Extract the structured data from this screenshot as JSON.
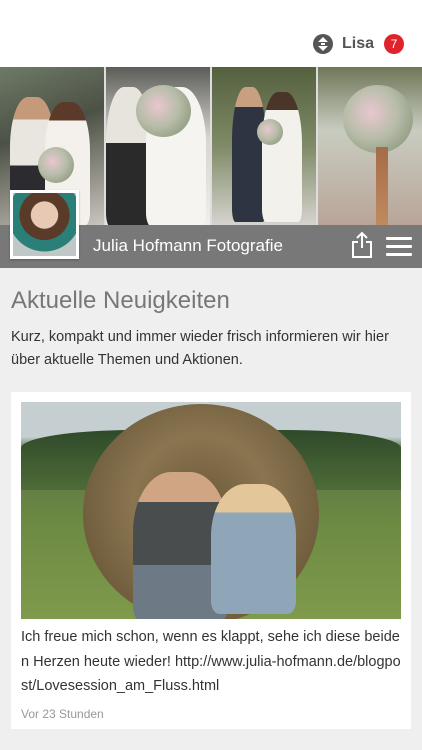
{
  "header": {
    "user_name": "Lisa",
    "notification_count": "7",
    "accent_color": "#e0222a"
  },
  "profile": {
    "name": "Julia Hofmann Fotografie",
    "icons": [
      "share-icon",
      "hamburger-menu-icon"
    ]
  },
  "news": {
    "title": "Aktuelle Neuigkeiten",
    "description": "Kurz, kompakt und immer wieder frisch informieren wir hier über aktuelle Themen und Aktionen."
  },
  "posts": [
    {
      "text": "Ich freue mich schon, wenn es klappt, sehe ich diese beiden Herzen heute wieder! http://www.julia-hofmann.de/blogpost/Lovesession_am_Fluss.html",
      "time": "Vor 23 Stunden"
    }
  ]
}
